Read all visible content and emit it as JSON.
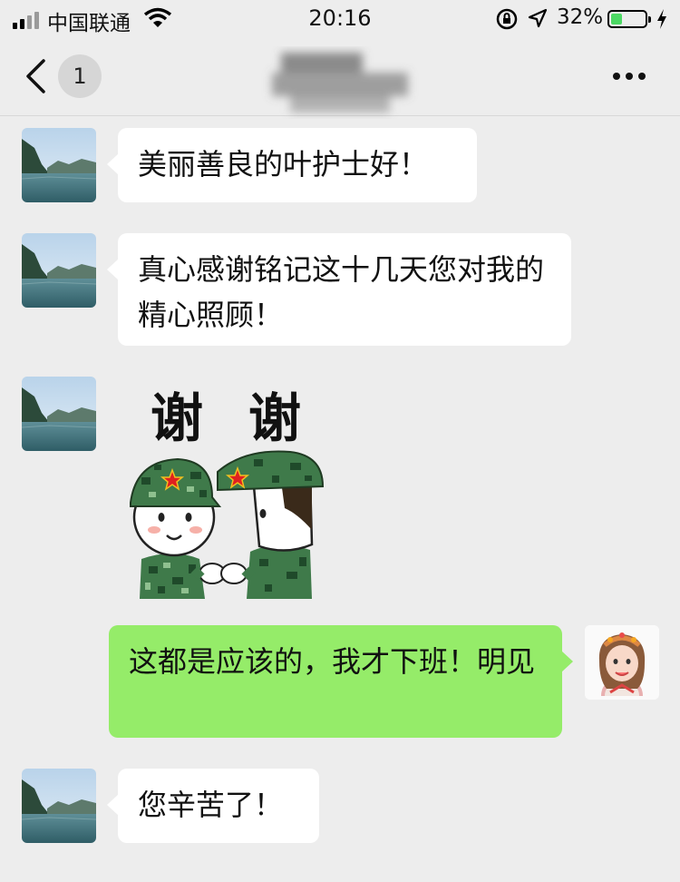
{
  "status_bar": {
    "carrier": "中国联通",
    "time": "20:16",
    "battery_percent": "32%",
    "battery_level": 0.32
  },
  "nav": {
    "back_icon": "chevron-left-icon",
    "unread_count": "1",
    "more_icon": "ellipsis-icon"
  },
  "messages": [
    {
      "side": "left",
      "type": "text",
      "text": "美丽善良的叶护士好！"
    },
    {
      "side": "left",
      "type": "text",
      "text": "真心感谢铭记这十几天您对我的精心照顾！"
    },
    {
      "side": "left",
      "type": "sticker",
      "sticker_text_1": "谢",
      "sticker_text_2": "谢"
    },
    {
      "side": "right",
      "type": "text",
      "text": "这都是应该的，我才下班！明见"
    },
    {
      "side": "left",
      "type": "text",
      "text": "您辛苦了！"
    }
  ],
  "colors": {
    "background": "#ededed",
    "own_bubble": "#95ec69",
    "other_bubble": "#ffffff",
    "battery_fill": "#4cd964"
  }
}
